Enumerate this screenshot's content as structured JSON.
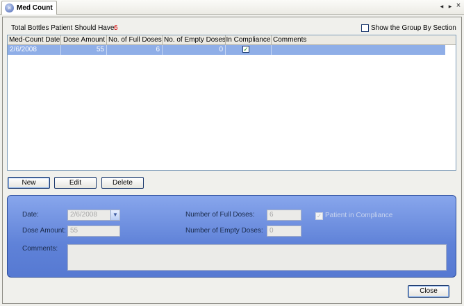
{
  "tab": {
    "title": "Med Count",
    "icon": "app-logo-icon"
  },
  "tab_controls": {
    "prev": "◂",
    "next": "▸",
    "close": "×"
  },
  "summary": {
    "total_label": "Total Bottles Patient Should Have:",
    "total_value": "6"
  },
  "group_by": {
    "label": "Show the Group By Section",
    "checked": false
  },
  "grid": {
    "columns": [
      "Med-Count Date",
      "Dose Amount",
      "No. of Full Doses",
      "No. of Empty Doses",
      "In Compliance",
      "Comments"
    ],
    "rows": [
      {
        "date": "2/6/2008",
        "dose_amount": "55",
        "full_doses": "6",
        "empty_doses": "0",
        "in_compliance": true,
        "comments": ""
      }
    ]
  },
  "actions": {
    "new": "New",
    "edit": "Edit",
    "delete": "Delete"
  },
  "details": {
    "date_label": "Date:",
    "date_value": "2/6/2008",
    "dose_amount_label": "Dose Amount:",
    "dose_amount_value": "55",
    "comments_label": "Comments:",
    "comments_value": "",
    "full_doses_label": "Number of Full Doses:",
    "full_doses_value": "6",
    "empty_doses_label": "Number of Empty Doses:",
    "empty_doses_value": "0",
    "compliance_label": "Patient in Compliance",
    "compliance_checked": true
  },
  "footer": {
    "close": "Close"
  },
  "colors": {
    "accent": "#e00000",
    "selection": "#8faee7",
    "panel": "#6d8ee0"
  }
}
